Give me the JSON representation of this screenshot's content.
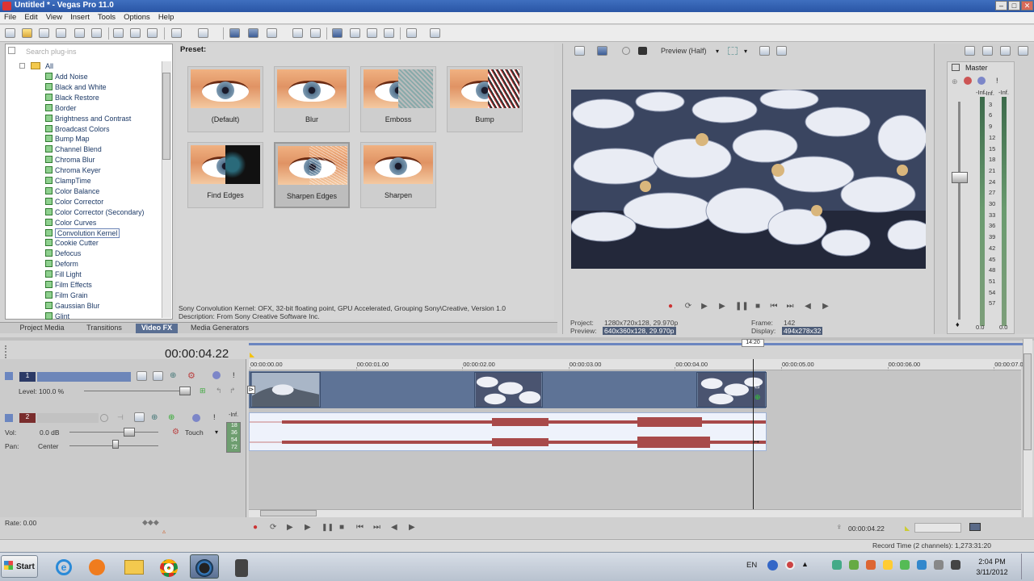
{
  "window": {
    "title": "Untitled * - Vegas Pro 11.0",
    "min": "–",
    "max": "□",
    "close": "✕"
  },
  "menu": [
    "File",
    "Edit",
    "View",
    "Insert",
    "Tools",
    "Options",
    "Help"
  ],
  "explorer": {
    "search_placeholder": "Search plug-ins",
    "root": "All",
    "items": [
      "Add Noise",
      "Black and White",
      "Black Restore",
      "Border",
      "Brightness and Contrast",
      "Broadcast Colors",
      "Bump Map",
      "Channel Blend",
      "Chroma Blur",
      "Chroma Keyer",
      "ClampTime",
      "Color Balance",
      "Color Corrector",
      "Color Corrector (Secondary)",
      "Color Curves",
      "Convolution Kernel",
      "Cookie Cutter",
      "Defocus",
      "Deform",
      "Fill Light",
      "Film Effects",
      "Film Grain",
      "Gaussian Blur",
      "Glint"
    ],
    "selected": "Convolution Kernel"
  },
  "tabs": [
    "Project Media",
    "Transitions",
    "Video FX",
    "Media Generators"
  ],
  "active_tab": "Video FX",
  "presets": {
    "heading": "Preset:",
    "items": [
      "(Default)",
      "Blur",
      "Emboss",
      "Bump",
      "Find Edges",
      "Sharpen Edges",
      "Sharpen"
    ],
    "selected": "Sharpen Edges",
    "description_1": "Sony Convolution Kernel: OFX, 32-bit floating point, GPU Accelerated, Grouping Sony\\Creative, Version 1.0",
    "description_2": "Description: From Sony Creative Software Inc."
  },
  "preview": {
    "mode": "Preview (Half)",
    "project_label": "Project:",
    "project_value": "1280x720x128, 29.970p",
    "preview_label": "Preview:",
    "preview_value": "640x360x128, 29.970p",
    "frame_label": "Frame:",
    "frame_value": "142",
    "display_label": "Display:",
    "display_value": "494x278x32"
  },
  "master": {
    "title": "Master",
    "scale": [
      "-Inf.",
      "3",
      "6",
      "9",
      "12",
      "15",
      "18",
      "21",
      "24",
      "27",
      "30",
      "33",
      "36",
      "39",
      "42",
      "45",
      "48",
      "51",
      "54",
      "57"
    ],
    "left_value": "0.0",
    "right_value": "0.0",
    "top_left": "-Inf.",
    "top_right": "-Inf."
  },
  "timeline": {
    "time": "00:00:04.22",
    "marker": "14:20",
    "ruler": [
      "00:00:00.00",
      "00:00:01.00",
      "00:00:02.00",
      "00:00:03.00",
      "00:00:04.00",
      "00:00:05.00",
      "00:00:06.00",
      "00:00:07.00"
    ],
    "video_track": {
      "number": "1",
      "level": "Level: 100.0 %"
    },
    "audio_track": {
      "number": "2",
      "vol_label": "Vol:",
      "vol_value": "0.0 dB",
      "pan_label": "Pan:",
      "pan_value": "Center",
      "mode": "Touch",
      "meter_top": "-Inf.",
      "meter_marks": [
        "18",
        "36",
        "54",
        "72"
      ]
    },
    "rate": "Rate: 0.00",
    "cursor_time": "00:00:04.22",
    "record_time": "Record Time (2 channels): 1,273:31:20"
  },
  "taskbar": {
    "start": "Start",
    "lang": "EN",
    "time": "2:04 PM",
    "date": "3/11/2012"
  }
}
